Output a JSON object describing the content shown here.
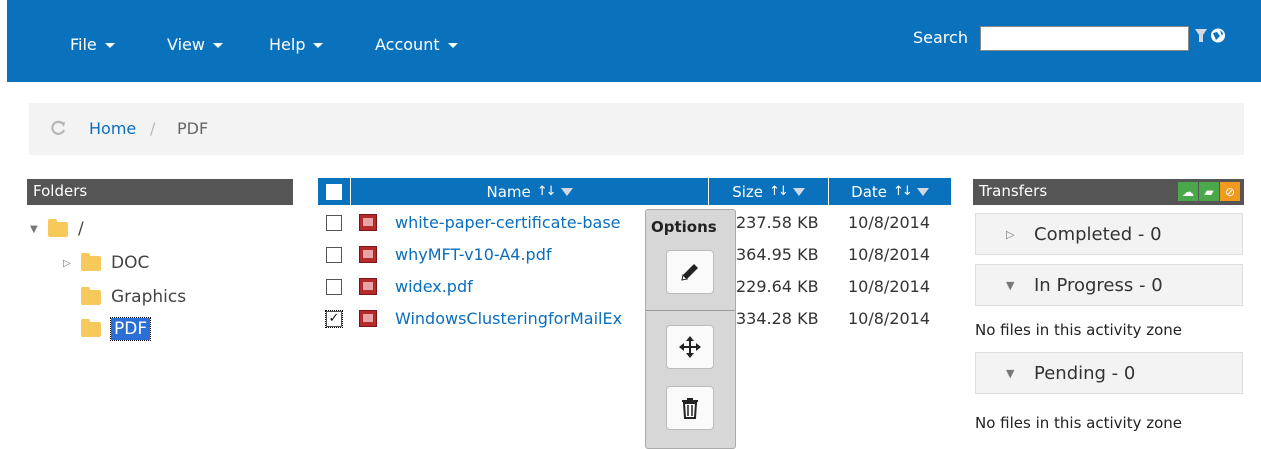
{
  "nav": {
    "menus": [
      {
        "label": "File"
      },
      {
        "label": "View"
      },
      {
        "label": "Help"
      },
      {
        "label": "Account"
      }
    ],
    "search_label": "Search",
    "search_value": "",
    "accent": "#0a72bd"
  },
  "breadcrumb": {
    "home": "Home",
    "separator": "/",
    "current": "PDF"
  },
  "folders": {
    "header": "Folders",
    "items": [
      {
        "label": "/",
        "expanded": true
      },
      {
        "label": "DOC",
        "expanded": false
      },
      {
        "label": "Graphics"
      },
      {
        "label": "PDF",
        "selected": true
      }
    ]
  },
  "files": {
    "columns": {
      "name": "Name",
      "size": "Size",
      "date": "Date"
    },
    "rows": [
      {
        "name": "white-paper-certificate-base",
        "size": "237.58 KB",
        "date": "10/8/2014",
        "checked": false
      },
      {
        "name": "whyMFT-v10-A4.pdf",
        "size": "364.95 KB",
        "date": "10/8/2014",
        "checked": false
      },
      {
        "name": "widex.pdf",
        "size": "229.64 KB",
        "date": "10/8/2014",
        "checked": false
      },
      {
        "name": "WindowsClusteringforMailEx",
        "size": "334.28 KB",
        "date": "10/8/2014",
        "checked": true
      }
    ]
  },
  "options": {
    "title": "Options",
    "buttons": [
      "pencil-icon",
      "move-icon",
      "trash-icon"
    ]
  },
  "transfers": {
    "header": "Transfers",
    "completed": "Completed - 0",
    "in_progress": "In Progress - 0",
    "pending": "Pending - 0",
    "empty_msg_1": "No files in this activity zone",
    "empty_msg_2": "No files in this activity zone"
  }
}
